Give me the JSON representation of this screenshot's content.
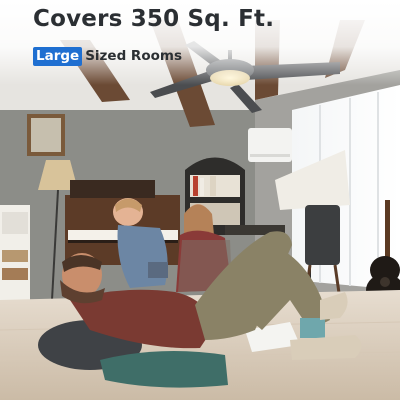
{
  "headline": "Covers 350 Sq. Ft.",
  "subheading": {
    "highlight": "Large",
    "rest": "Sized Rooms"
  },
  "colors": {
    "highlight_badge": "#1f6fd1",
    "heading_text": "#2b2f33"
  }
}
